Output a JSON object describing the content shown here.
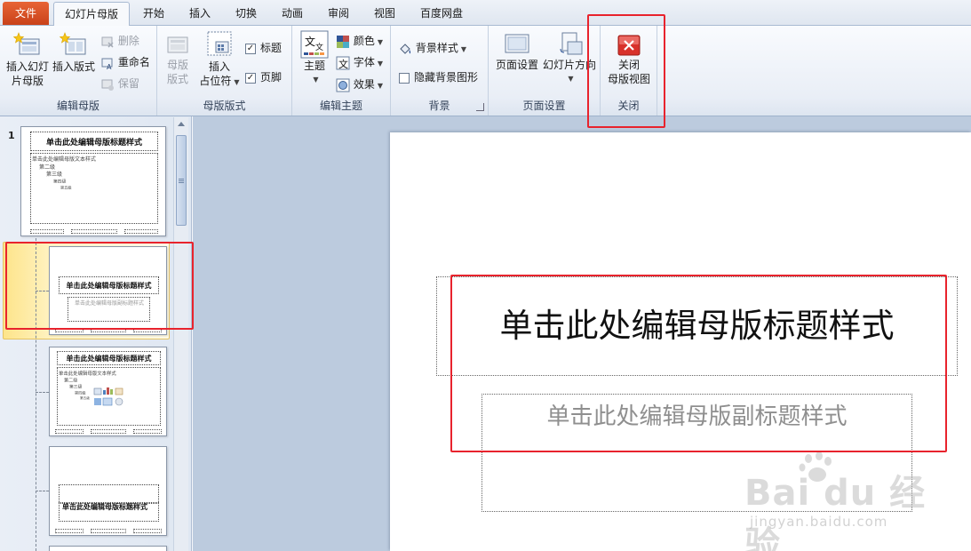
{
  "tabs": [
    {
      "label": "文件"
    },
    {
      "label": "幻灯片母版"
    },
    {
      "label": "开始"
    },
    {
      "label": "插入"
    },
    {
      "label": "切换"
    },
    {
      "label": "动画"
    },
    {
      "label": "审阅"
    },
    {
      "label": "视图"
    },
    {
      "label": "百度网盘"
    }
  ],
  "ribbon": {
    "edit_master": {
      "label": "编辑母版",
      "insert_master_l1": "插入幻灯",
      "insert_master_l2": "片母版",
      "insert_layout": "插入版式",
      "delete": "删除",
      "rename": "重命名",
      "preserve": "保留"
    },
    "master_layout": {
      "label": "母版版式",
      "master_layout_l1": "母版",
      "master_layout_l2": "版式",
      "insert_placeholder_l1": "插入",
      "insert_placeholder_l2": "占位符",
      "title_check": "标题",
      "footer_check": "页脚"
    },
    "edit_theme": {
      "label": "编辑主题",
      "theme": "主题",
      "colors": "颜色",
      "fonts": "字体",
      "effects": "效果"
    },
    "background": {
      "label": "背景",
      "bg_styles": "背景样式",
      "hide_bg": "隐藏背景图形"
    },
    "page_setup": {
      "label": "页面设置",
      "page_setup_btn": "页面设置",
      "orientation": "幻灯片方向"
    },
    "close": {
      "label": "关闭",
      "close_l1": "关闭",
      "close_l2": "母版视图"
    }
  },
  "thumbnails": {
    "slide_number": "1",
    "master_title": "单击此处编辑母版标题样式",
    "master_text": "单击此处编辑母版文本样式",
    "level2": "第二级",
    "level3": "第三级",
    "level4": "第四级",
    "level5": "第五级",
    "layout_title": "单击此处编辑母版标题样式",
    "layout_subtitle": "单击此处编辑母版副标题样式",
    "section_title": "单击此处编辑母版标题样式"
  },
  "slide": {
    "title": "单击此处编辑母版标题样式",
    "subtitle": "单击此处编辑母版副标题样式"
  },
  "watermark": {
    "main": "Bai du 经验",
    "sub": "jingyan.baidu.com"
  },
  "colors": {
    "file_tab": "#d9532a",
    "annotation_red": "#e8232d",
    "close_icon": "#d8322c"
  }
}
